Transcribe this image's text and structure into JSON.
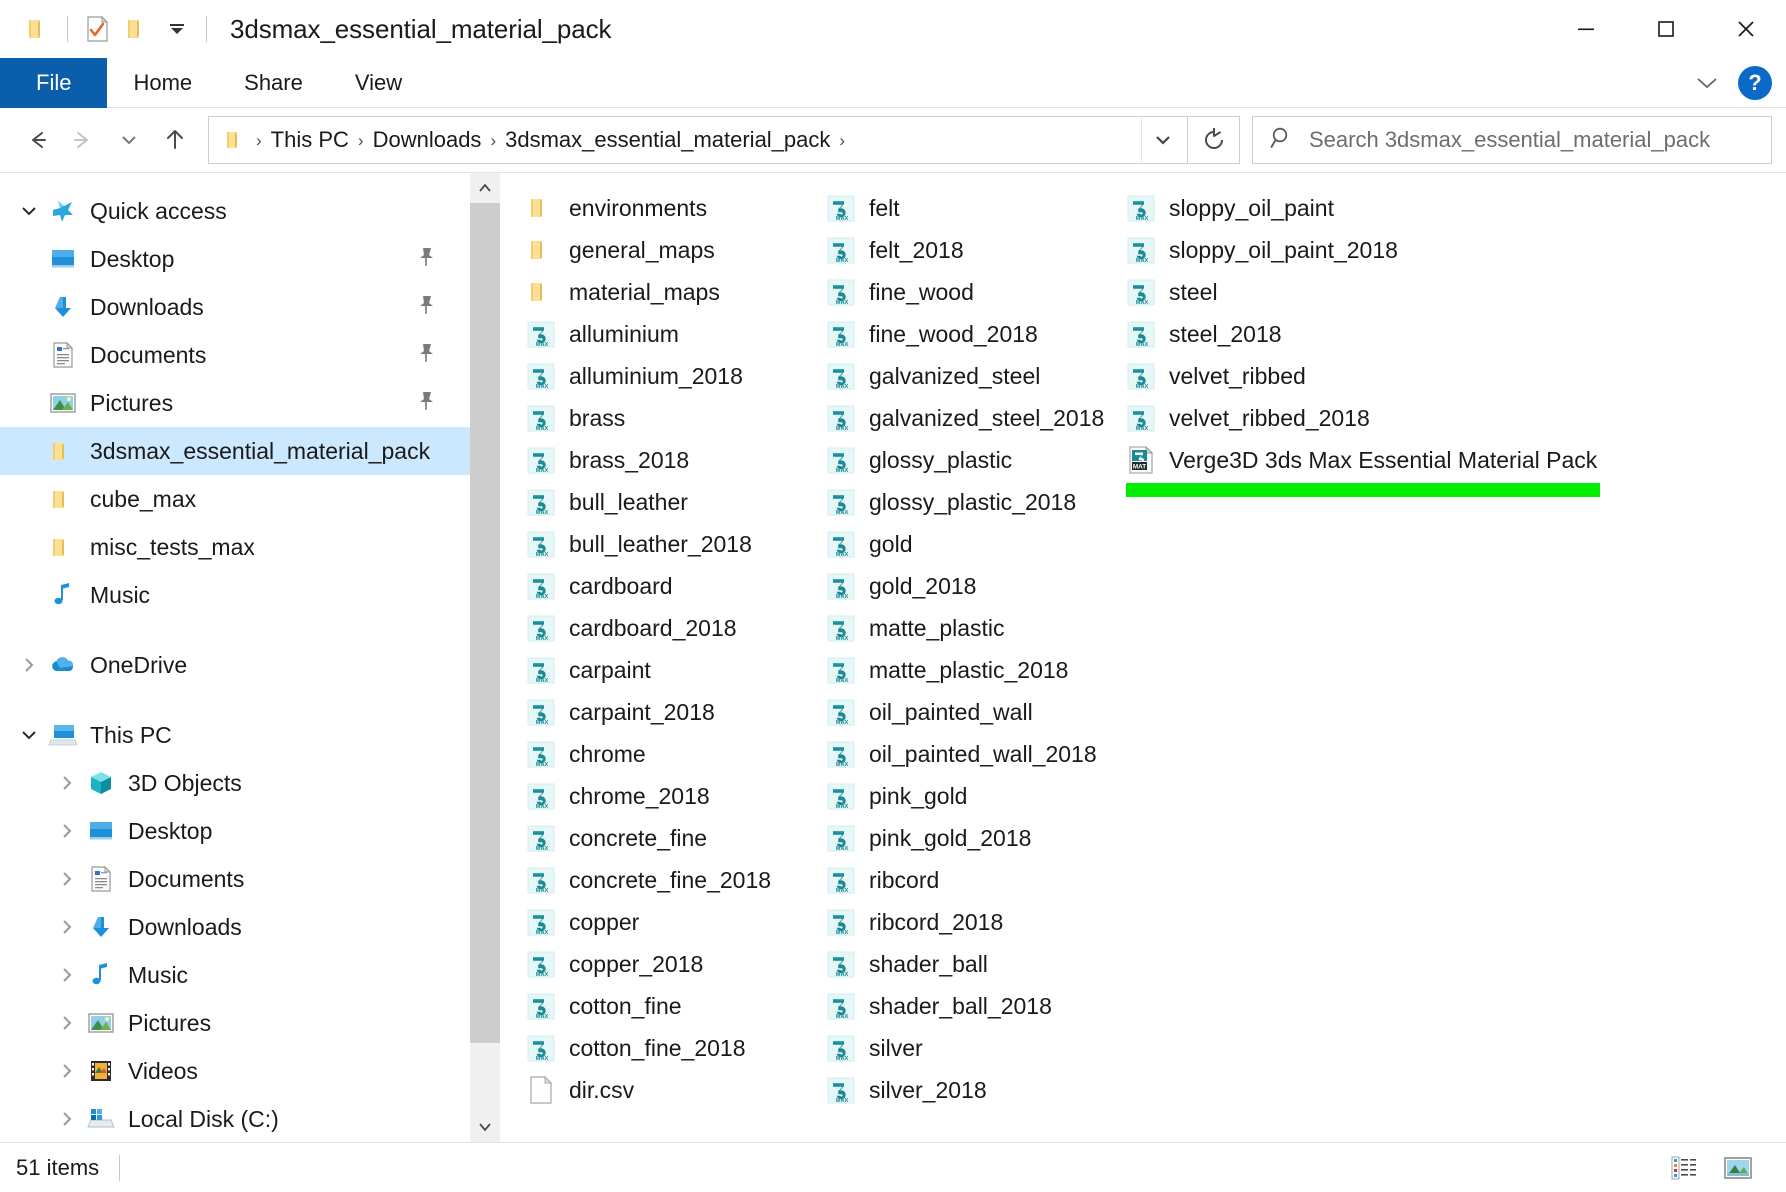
{
  "window": {
    "title": "3dsmax_essential_material_pack",
    "quick_access": [
      {
        "name": "folder-icon",
        "label": "Folder"
      },
      {
        "name": "properties-icon",
        "label": "Properties"
      },
      {
        "name": "new-folder-icon",
        "label": "New folder"
      },
      {
        "name": "customize-dropdown-icon",
        "label": "Customize Quick Access Toolbar"
      }
    ],
    "controls": {
      "minimize": "—",
      "maximize": "□",
      "close": "✕"
    }
  },
  "ribbon": {
    "tabs": [
      {
        "label": "File",
        "active": true
      },
      {
        "label": "Home",
        "active": false
      },
      {
        "label": "Share",
        "active": false
      },
      {
        "label": "View",
        "active": false
      }
    ],
    "expand_label": "⌄",
    "help_label": "?"
  },
  "nav": {
    "back": "←",
    "forward": "→",
    "recent": "⌄",
    "up": "↑",
    "breadcrumbs": [
      "This PC",
      "Downloads",
      "3dsmax_essential_material_pack"
    ],
    "separator": "›",
    "dropdown": "⌄",
    "refresh": "↻"
  },
  "search": {
    "placeholder": "Search 3dsmax_essential_material_pack",
    "value": ""
  },
  "sidebar": {
    "groups": [
      {
        "name": "quick-access",
        "label": "Quick access",
        "icon": "star-icon",
        "expander": "chevron-down",
        "items": [
          {
            "label": "Desktop",
            "icon": "desktop-icon",
            "pinned": true
          },
          {
            "label": "Downloads",
            "icon": "downloads-icon",
            "pinned": true
          },
          {
            "label": "Documents",
            "icon": "documents-icon",
            "pinned": true
          },
          {
            "label": "Pictures",
            "icon": "pictures-icon",
            "pinned": true
          },
          {
            "label": "3dsmax_essential_material_pack",
            "icon": "folder-icon",
            "pinned": false,
            "selected": true
          },
          {
            "label": "cube_max",
            "icon": "folder-icon",
            "pinned": false
          },
          {
            "label": "misc_tests_max",
            "icon": "folder-icon",
            "pinned": false
          },
          {
            "label": "Music",
            "icon": "music-icon",
            "pinned": false
          }
        ]
      },
      {
        "name": "onedrive",
        "label": "OneDrive",
        "icon": "onedrive-icon",
        "expander": "chevron-right",
        "items": []
      },
      {
        "name": "this-pc",
        "label": "This PC",
        "icon": "this-pc-icon",
        "expander": "chevron-down",
        "items": [
          {
            "label": "3D Objects",
            "icon": "3d-objects-icon",
            "expander": "chevron-right"
          },
          {
            "label": "Desktop",
            "icon": "desktop-icon",
            "expander": "chevron-right"
          },
          {
            "label": "Documents",
            "icon": "documents-icon",
            "expander": "chevron-right"
          },
          {
            "label": "Downloads",
            "icon": "downloads-icon",
            "expander": "chevron-right"
          },
          {
            "label": "Music",
            "icon": "music-icon",
            "expander": "chevron-right"
          },
          {
            "label": "Pictures",
            "icon": "pictures-icon",
            "expander": "chevron-right"
          },
          {
            "label": "Videos",
            "icon": "videos-icon",
            "expander": "chevron-right"
          },
          {
            "label": "Local Disk (C:)",
            "icon": "local-disk-icon",
            "expander": "chevron-right"
          }
        ]
      }
    ]
  },
  "files": {
    "scroll": {
      "up_arrow": "⌃",
      "down_arrow": "⌄"
    },
    "columns": [
      {
        "items": [
          {
            "label": "environments",
            "icon": "folder-icon"
          },
          {
            "label": "general_maps",
            "icon": "folder-icon"
          },
          {
            "label": "material_maps",
            "icon": "folder-icon"
          },
          {
            "label": "alluminium",
            "icon": "max-file-icon"
          },
          {
            "label": "alluminium_2018",
            "icon": "max-file-icon"
          },
          {
            "label": "brass",
            "icon": "max-file-icon"
          },
          {
            "label": "brass_2018",
            "icon": "max-file-icon"
          },
          {
            "label": "bull_leather",
            "icon": "max-file-icon"
          },
          {
            "label": "bull_leather_2018",
            "icon": "max-file-icon"
          },
          {
            "label": "cardboard",
            "icon": "max-file-icon"
          },
          {
            "label": "cardboard_2018",
            "icon": "max-file-icon"
          },
          {
            "label": "carpaint",
            "icon": "max-file-icon"
          },
          {
            "label": "carpaint_2018",
            "icon": "max-file-icon"
          },
          {
            "label": "chrome",
            "icon": "max-file-icon"
          },
          {
            "label": "chrome_2018",
            "icon": "max-file-icon"
          },
          {
            "label": "concrete_fine",
            "icon": "max-file-icon"
          },
          {
            "label": "concrete_fine_2018",
            "icon": "max-file-icon"
          },
          {
            "label": "copper",
            "icon": "max-file-icon"
          },
          {
            "label": "copper_2018",
            "icon": "max-file-icon"
          },
          {
            "label": "cotton_fine",
            "icon": "max-file-icon"
          },
          {
            "label": "cotton_fine_2018",
            "icon": "max-file-icon"
          },
          {
            "label": "dir.csv",
            "icon": "generic-file-icon"
          }
        ]
      },
      {
        "items": [
          {
            "label": "felt",
            "icon": "max-file-icon"
          },
          {
            "label": "felt_2018",
            "icon": "max-file-icon"
          },
          {
            "label": "fine_wood",
            "icon": "max-file-icon"
          },
          {
            "label": "fine_wood_2018",
            "icon": "max-file-icon"
          },
          {
            "label": "galvanized_steel",
            "icon": "max-file-icon"
          },
          {
            "label": "galvanized_steel_2018",
            "icon": "max-file-icon"
          },
          {
            "label": "glossy_plastic",
            "icon": "max-file-icon"
          },
          {
            "label": "glossy_plastic_2018",
            "icon": "max-file-icon"
          },
          {
            "label": "gold",
            "icon": "max-file-icon"
          },
          {
            "label": "gold_2018",
            "icon": "max-file-icon"
          },
          {
            "label": "matte_plastic",
            "icon": "max-file-icon"
          },
          {
            "label": "matte_plastic_2018",
            "icon": "max-file-icon"
          },
          {
            "label": "oil_painted_wall",
            "icon": "max-file-icon"
          },
          {
            "label": "oil_painted_wall_2018",
            "icon": "max-file-icon"
          },
          {
            "label": "pink_gold",
            "icon": "max-file-icon"
          },
          {
            "label": "pink_gold_2018",
            "icon": "max-file-icon"
          },
          {
            "label": "ribcord",
            "icon": "max-file-icon"
          },
          {
            "label": "ribcord_2018",
            "icon": "max-file-icon"
          },
          {
            "label": "shader_ball",
            "icon": "max-file-icon"
          },
          {
            "label": "shader_ball_2018",
            "icon": "max-file-icon"
          },
          {
            "label": "silver",
            "icon": "max-file-icon"
          },
          {
            "label": "silver_2018",
            "icon": "max-file-icon"
          }
        ]
      },
      {
        "items": [
          {
            "label": "sloppy_oil_paint",
            "icon": "max-file-icon"
          },
          {
            "label": "sloppy_oil_paint_2018",
            "icon": "max-file-icon"
          },
          {
            "label": "steel",
            "icon": "max-file-icon"
          },
          {
            "label": "steel_2018",
            "icon": "max-file-icon"
          },
          {
            "label": "velvet_ribbed",
            "icon": "max-file-icon"
          },
          {
            "label": "velvet_ribbed_2018",
            "icon": "max-file-icon"
          },
          {
            "label": "Verge3D 3ds Max Essential Material Pack",
            "icon": "mat-file-icon",
            "highlight": true
          }
        ]
      }
    ],
    "highlight_color": "#00ee00"
  },
  "status": {
    "item_count": "51 items",
    "views": [
      {
        "name": "details-view-button",
        "label": "Details"
      },
      {
        "name": "large-icons-view-button",
        "label": "Large icons"
      }
    ]
  },
  "colors": {
    "accent": "#0b5eac",
    "selection": "#cce8ff",
    "highlight_green": "#00ee00",
    "max_teal": "#1c8c96",
    "folder_yellow": "#f7d073"
  }
}
